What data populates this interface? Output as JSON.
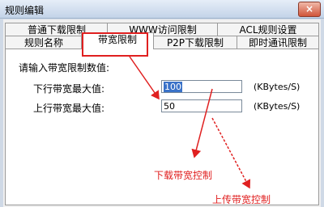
{
  "window": {
    "title": "规则编辑",
    "close_glyph": "×"
  },
  "tabs_row1": [
    "普通下载限制",
    "WWW访问限制",
    "ACL规则设置"
  ],
  "tabs_row2": [
    "规则名称",
    "带宽限制",
    "P2P下载限制",
    "即时通讯限制"
  ],
  "panel": {
    "prompt": "请输入带宽限制数值:",
    "download_label": "下行带宽最大值:",
    "download_value": "100",
    "upload_label": "上行带宽最大值:",
    "upload_value": "50",
    "unit_download": "(KBytes/S)",
    "unit_upload": "(KBytes/S)"
  },
  "annotations": {
    "download_control": "下载带宽控制",
    "upload_control": "上传带宽控制",
    "color": "#e02020"
  }
}
